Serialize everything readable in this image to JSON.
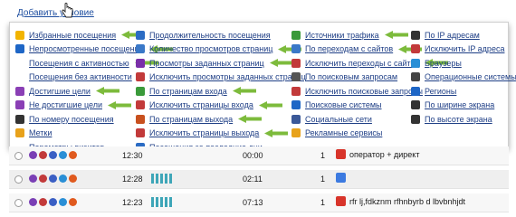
{
  "header": {
    "add_condition_label": "Добавить условие"
  },
  "colors": {
    "link": "#1f3f86",
    "arrow": "#7dbb3c",
    "bars": "#3ea6b8"
  },
  "columns": [
    {
      "items": [
        {
          "label": "Избранные посещения",
          "icon": "star-icon",
          "color": "#f2b400",
          "arrow": true
        },
        {
          "label": "Непросмотренные посещения",
          "icon": "eye-icon",
          "color": "#1e66c6",
          "arrow": true
        },
        {
          "label": "Посещения с активностью",
          "icon": "",
          "color": "",
          "arrow": true
        },
        {
          "label": "Посещения без активности",
          "icon": "",
          "color": "",
          "arrow": false
        },
        {
          "label": "Достигшие цели",
          "icon": "target-icon",
          "color": "#8a3fb5",
          "arrow": true
        },
        {
          "label": "Не достигшие цели",
          "icon": "target-off-icon",
          "color": "#8a3fb5",
          "arrow": true
        },
        {
          "label": "По номеру посещения",
          "icon": "hash-icon",
          "color": "#333333",
          "arrow": false
        },
        {
          "label": "Метки",
          "icon": "tag-icon",
          "color": "#e8a21b",
          "arrow": false
        },
        {
          "label": "Параметры визитов",
          "icon": "",
          "color": "",
          "arrow": false
        }
      ]
    },
    {
      "items": [
        {
          "label": "Продолжительность посещения",
          "icon": "clock-icon",
          "color": "#2b6cc4",
          "arrow": false
        },
        {
          "label": "Количество просмотров страниц",
          "icon": "pages-icon",
          "color": "#3a78c8",
          "arrow": true
        },
        {
          "label": "Просмотры заданных страниц",
          "icon": "check-icon",
          "color": "#7a2fa8",
          "arrow": true
        },
        {
          "label": "Исключить просмотры заданных страниц",
          "icon": "cross-check-icon",
          "color": "#c23a3a",
          "arrow": false
        },
        {
          "label": "По страницам входа",
          "icon": "enter-icon",
          "color": "#3a9a3a",
          "arrow": true
        },
        {
          "label": "Исключить страницы входа",
          "icon": "enter-off-icon",
          "color": "#c23a3a",
          "arrow": true
        },
        {
          "label": "По страницам выхода",
          "icon": "exit-icon",
          "color": "#c8501e",
          "arrow": true
        },
        {
          "label": "Исключить страницы выхода",
          "icon": "exit-off-icon",
          "color": "#c23a3a",
          "arrow": true
        },
        {
          "label": "Посещения за последние дни",
          "icon": "calendar-icon",
          "color": "#2b6cc4",
          "arrow": false
        }
      ]
    },
    {
      "items": [
        {
          "label": "Источники трафика",
          "icon": "traffic-icon",
          "color": "#3a9a3a",
          "arrow": true
        },
        {
          "label": "По переходам с сайтов",
          "icon": "link-icon",
          "color": "#3a78c8",
          "arrow": true
        },
        {
          "label": "Исключить переходы с сайтов",
          "icon": "link-off-icon",
          "color": "#c23a3a",
          "arrow": true
        },
        {
          "label": "По поисковым запросам",
          "icon": "search-icon",
          "color": "#555555",
          "arrow": false
        },
        {
          "label": "Исключить поисковые запросы",
          "icon": "search-off-icon",
          "color": "#c23a3a",
          "arrow": false
        },
        {
          "label": "Поисковые системы",
          "icon": "search-engines-icon",
          "color": "#1e66c6",
          "arrow": false
        },
        {
          "label": "Социальные сети",
          "icon": "social-icon",
          "color": "#3b5998",
          "arrow": false
        },
        {
          "label": "Рекламные сервисы",
          "icon": "ads-icon",
          "color": "#e8a21b",
          "arrow": false
        }
      ]
    },
    {
      "items": [
        {
          "label": "По IP адресам",
          "icon": "ip-icon",
          "color": "#333333",
          "arrow": false
        },
        {
          "label": "Исключить IP адреса",
          "icon": "ip-off-icon",
          "color": "#c23a3a",
          "arrow": false
        },
        {
          "label": "Браузеры",
          "icon": "browser-icon",
          "color": "#2a8fd6",
          "arrow": false
        },
        {
          "label": "Операционные системы",
          "icon": "os-icon",
          "color": "#444444",
          "arrow": false
        },
        {
          "label": "Регионы",
          "icon": "globe-icon",
          "color": "#1e66c6",
          "arrow": false
        },
        {
          "label": "По ширине экрана",
          "icon": "screen-width-icon",
          "color": "#333333",
          "arrow": false
        },
        {
          "label": "По высоте экрана",
          "icon": "screen-height-icon",
          "color": "#333333",
          "arrow": false
        }
      ]
    }
  ],
  "rows": [
    {
      "time": "12:30",
      "bars": 0,
      "duration": "00:00",
      "count": "1",
      "source_text": "оператор + директ",
      "source_icon": "yandex-icon",
      "source_color": "#d8342a"
    },
    {
      "time": "12:28",
      "bars": 5,
      "duration": "02:11",
      "count": "1",
      "source_text": "",
      "source_icon": "google-icon",
      "source_color": "#3c7ae0"
    },
    {
      "time": "12:23",
      "bars": 5,
      "duration": "07:13",
      "count": "1",
      "source_text": "rfr lj,fdkznm rfhnbyrb d lbvbnhjdt",
      "source_icon": "yandex-icon",
      "source_color": "#d8342a"
    }
  ]
}
